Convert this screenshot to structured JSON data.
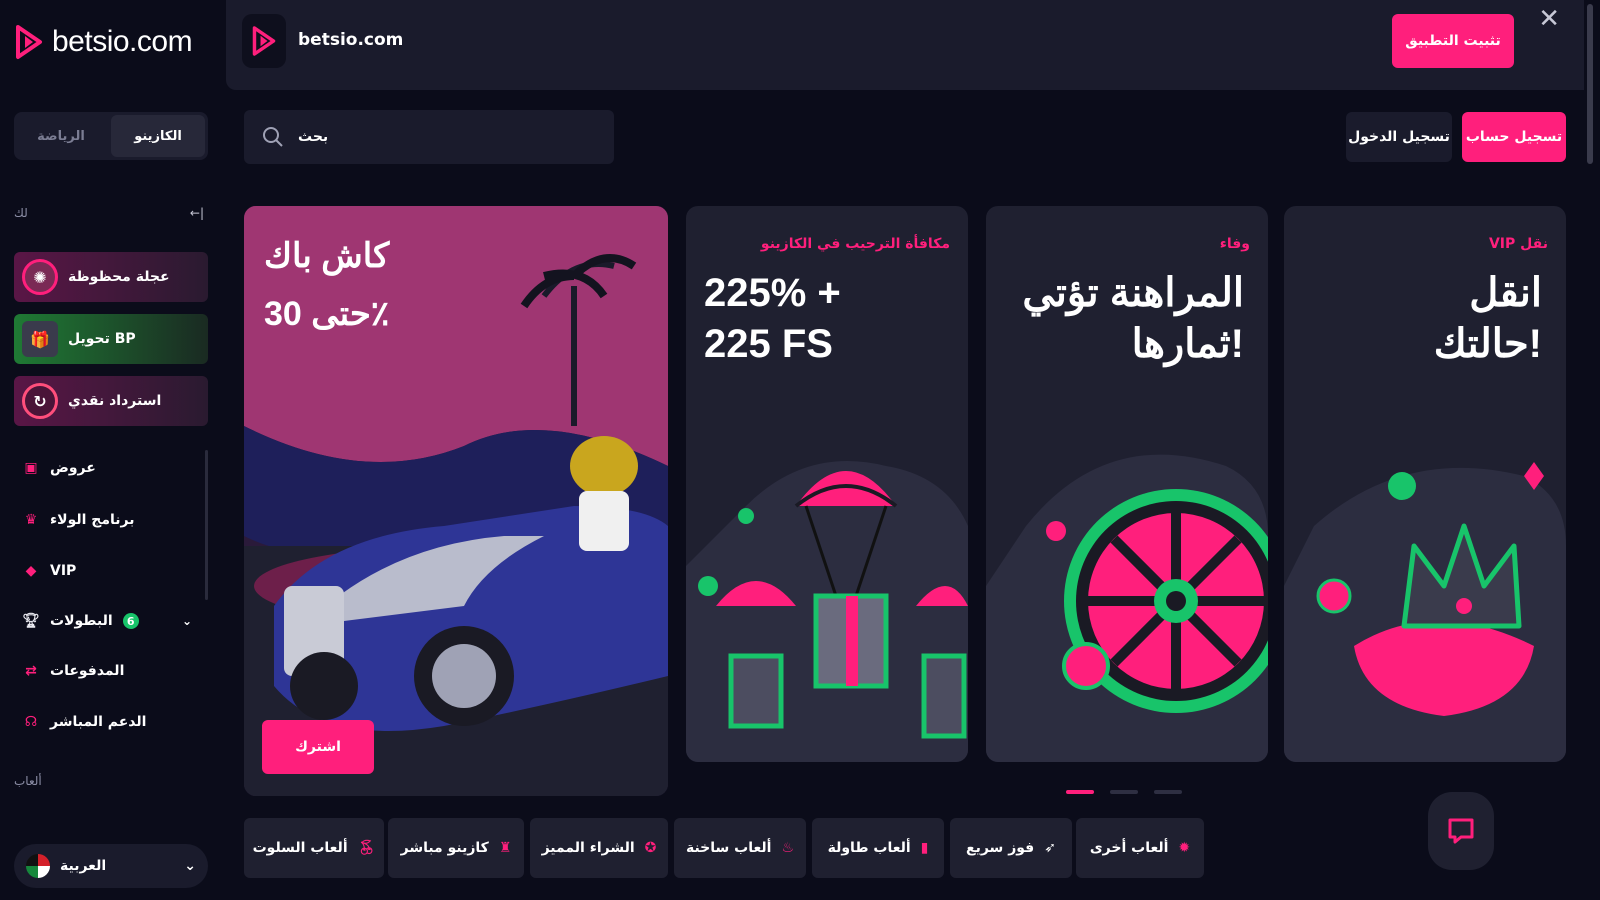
{
  "sidebar": {
    "logo_text": "betsio.com",
    "tabs": {
      "sports": "الرياضة",
      "casino": "الكازينو"
    },
    "collapse_label": "لك",
    "promos": [
      {
        "label": "عجلة محظوظة",
        "color": "#4a1438"
      },
      {
        "label": "تحويل BP",
        "color": "#1b5c2b"
      },
      {
        "label": "استرداد نقدي",
        "color": "#4a1438"
      }
    ],
    "nav": [
      {
        "label": "عروض",
        "icon": "gift-icon"
      },
      {
        "label": "برنامج الولاء",
        "icon": "crown-icon"
      },
      {
        "label": "VIP",
        "icon": "diamond-icon"
      },
      {
        "label": "البطولات",
        "icon": "trophy-icon",
        "badge": "6"
      },
      {
        "label": "المدفوعات",
        "icon": "payment-icon"
      },
      {
        "label": "الدعم المباشر",
        "icon": "headset-icon"
      }
    ],
    "games_section": "ألعاب",
    "language": "العربية"
  },
  "banner": {
    "app_name": "betsio.com",
    "install_label": "تثبيت التطبيق"
  },
  "header": {
    "search_placeholder": "بحث",
    "login_label": "تسجيل الدخول",
    "signup_label": "تسجيل حساب"
  },
  "cards": {
    "hero": {
      "title_line1": "كاش باك",
      "title_line2": "حتى 30٪",
      "button": "اشترك"
    },
    "welcome": {
      "pre": "مكافأة الترحيب في الكازينو",
      "line1": "225% +",
      "line2": "225 FS"
    },
    "loyalty": {
      "pre": "وفاء",
      "line1": "المراهنة تؤتي",
      "line2": "ثمارها!"
    },
    "vip": {
      "pre": "VIP نقل",
      "line1": "انقل",
      "line2": "حالتك!"
    }
  },
  "categories": [
    {
      "label": "ألعاب السلوت",
      "icon": "slots-icon"
    },
    {
      "label": "كازينو مباشر",
      "icon": "dealer-icon"
    },
    {
      "label": "الشراء المميز",
      "icon": "star-icon"
    },
    {
      "label": "ألعاب ساخنة",
      "icon": "fire-icon"
    },
    {
      "label": "ألعاب طاولة",
      "icon": "cards-icon"
    },
    {
      "label": "فوز سريع",
      "icon": "rocket-icon"
    },
    {
      "label": "ألعاب أخرى",
      "icon": "chip-icon"
    }
  ],
  "colors": {
    "accent": "#ff1f7c",
    "bg": "#0b0c1a",
    "panel": "#1a1b2c",
    "green": "#18c46a"
  }
}
